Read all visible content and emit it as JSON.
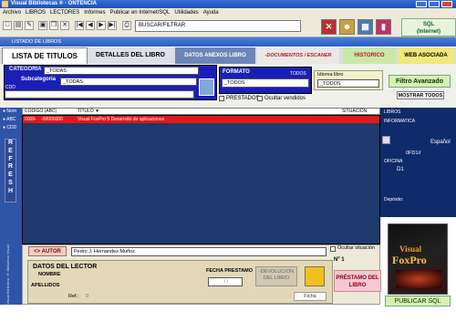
{
  "window": {
    "title": "Visual Bibliotecas ® - ONTENCIA"
  },
  "menu": [
    "Archivo",
    "LIBROS",
    "LECTORES",
    "Informes",
    "Publicar en Internet/SQL",
    "Utilidades",
    "Ayuda"
  ],
  "toolbar": {
    "search_value": "BUSCAR/FILTRAR",
    "sql_label_1": "SQL",
    "sql_label_2": "(Internet)"
  },
  "subwindow": {
    "title": "LISTADO DE LIBROS"
  },
  "tabs": {
    "lista": "LISTA DE TITULOS",
    "detalles": "DETALLES DEL LIBRO",
    "anexos": "DATOS ANEXOS LIBRO",
    "documentos": "-DOCUMENTOS / ESCANER",
    "historico": "HISTORICO",
    "web": "WEB ASOCIADA"
  },
  "filters": {
    "categoria_label": "CATEGORIA",
    "categoria_value": "_TODAS",
    "subcategoria_label": "Subcategoria",
    "subcategoria_value": "_TODAS",
    "cdd_label": "CDD",
    "formato_label": "FORMATO",
    "formato_todos": "TODOS",
    "formato_value": "_TODOS",
    "idioma_label": "Idioma libro",
    "idioma_value": "_TODOS",
    "prestados_label": "PRESTADOS",
    "ocultar_vendidos_label": "Ocultar vendidos",
    "filtro_avanzado": "Filtro Avanzado",
    "mostrar_todos": "MOSTRAR TODOS"
  },
  "sort": {
    "nom": "Nom",
    "abc": "ABC",
    "cdd": "CDD"
  },
  "grid": {
    "headers": {
      "codigo": "CÓDIGO (ABC)",
      "titulo": "TÍTULO ▼",
      "situacion": "SITUACIÓN"
    },
    "rows": [
      {
        "codigo": "0000-",
        "codigo2": "-00000000",
        "titulo": "Visual FoxPro 5 Desarrollo de aplicaciones",
        "situacion": ""
      }
    ]
  },
  "refresh_label": "REFRESH",
  "side_label": "Visual Biblioteca ® Biblioteca Visual",
  "info": {
    "libros": "LIBROS",
    "informatica": "INFORMATICA",
    "idioma": "Español",
    "code": "0FD1//",
    "oficina_label": "OFICINA",
    "oficina_value": "D1",
    "deposito_label": "Depósito:"
  },
  "lector": {
    "autor_button": "<> AUTOR",
    "autor_value": "Pedro J. Hernandez Muñoz",
    "ocultar_situacion": "Ocultar situación",
    "numero": "Nº 1",
    "datos_title": "DATOS DEL LECTOR",
    "nombre": "NOMBRE",
    "apellidos": "APELLIDOS",
    "ref": "Ref.:",
    "ref_value": "0",
    "fecha_label": "FECHA PRESTAMO",
    "fecha_value": "/ /",
    "devolucion": "-DEVOLUCIÓN DEL LIBRO",
    "ficha": "Ficha",
    "prestamo": "PRÉSTAMO DEL LIBRO"
  },
  "book": {
    "title_1": "Visual",
    "title_2": "FoxPro"
  },
  "publicar": "PUBLICAR SQL",
  "colors": {
    "accent": "#1a1fb8",
    "row_selected": "#e31818",
    "grid_bg": "#1e3a6e"
  }
}
